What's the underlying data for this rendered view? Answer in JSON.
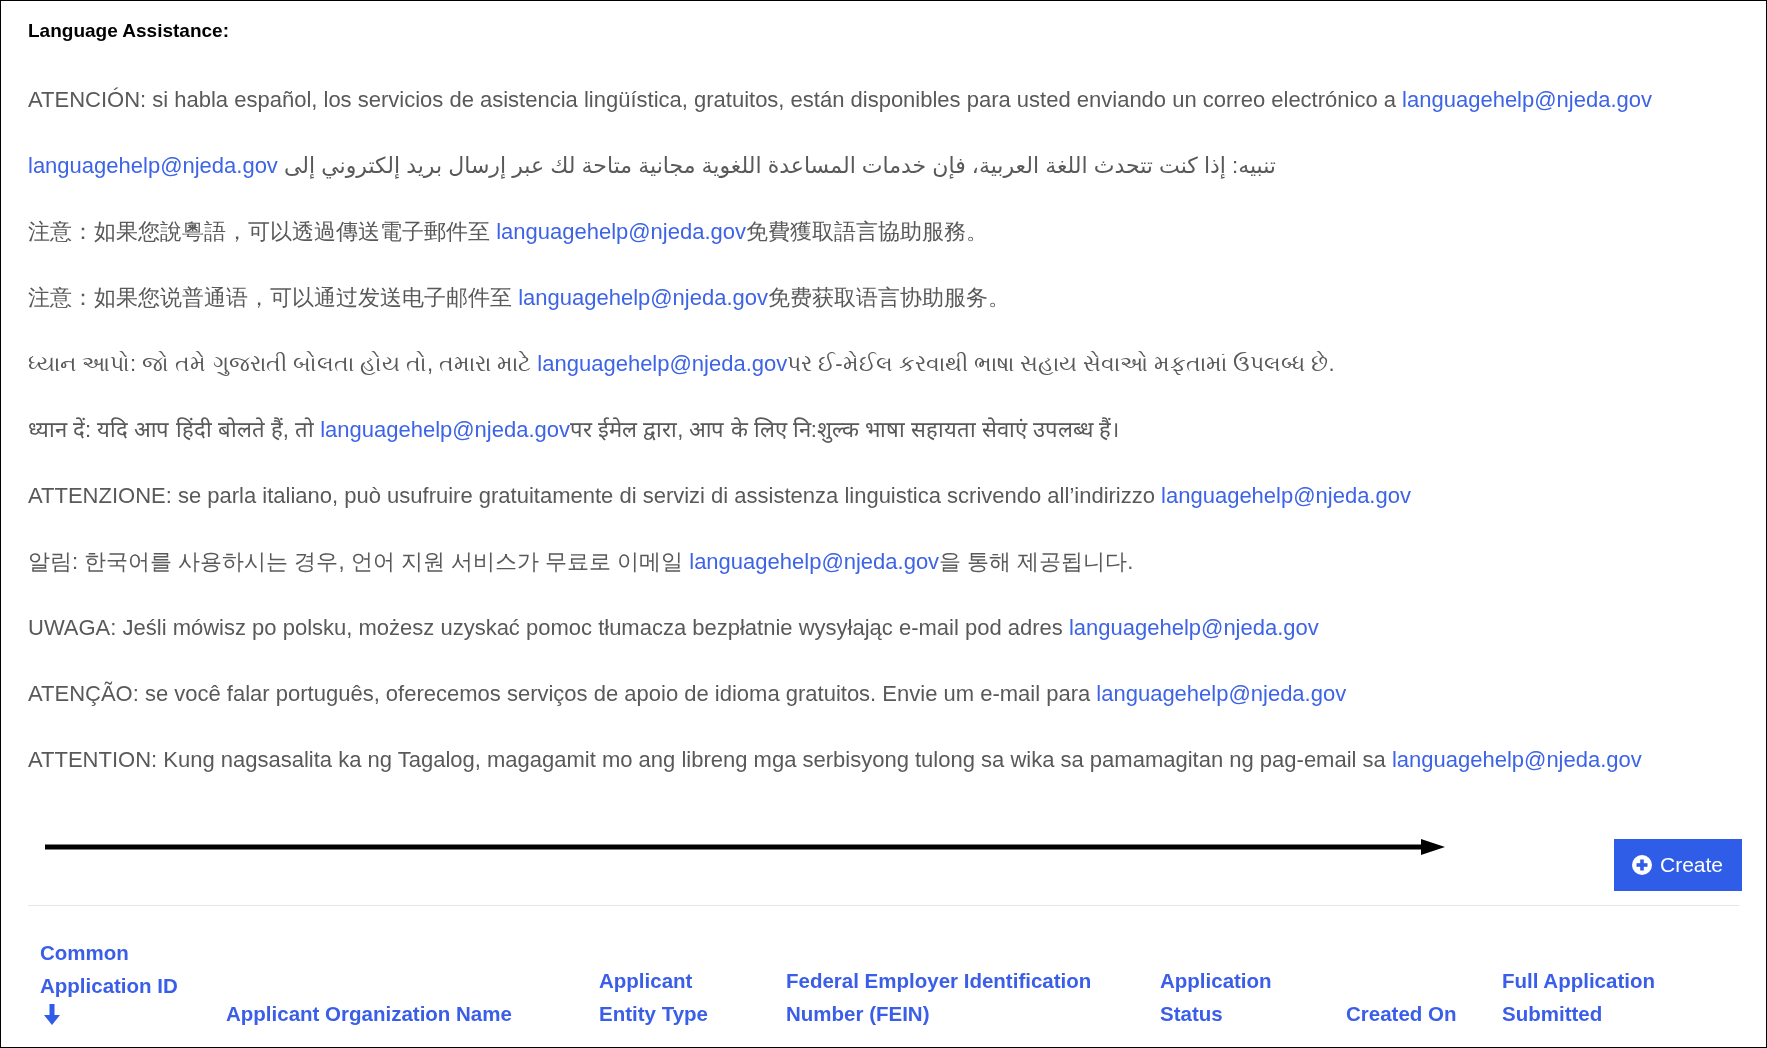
{
  "heading": "Language Assistance:",
  "notices": [
    {
      "before": "ATENCIÓN: si habla español, los servicios de asistencia lingüística, gratuitos, están disponibles para usted enviando un correo electrónico a",
      "email": "languagehelp@njeda.gov"
    },
    {
      "kind": "rtl",
      "before": "تنبيه: إذا كنت تتحدث اللغة العربية، فإن خدمات المساعدة اللغوية مجانية متاحة لك عبر إرسال بريد إلكتروني إلى",
      "email": "languagehelp@njeda.gov"
    },
    {
      "before": "注意：如果您說粵語，可以透過傳送電子郵件至",
      "email": "languagehelp@njeda.gov",
      "after": "免費獲取語言協助服務。"
    },
    {
      "before": "注意：如果您说普通语，可以通过发送电子邮件至",
      "email": "languagehelp@njeda.gov",
      "after": "免费获取语言协助服务。"
    },
    {
      "before": "ધ્યાન આપો: જો તમે ગુજરાતી બોલતા હોય તો, તમારા માટે",
      "email": "languagehelp@njeda.gov",
      "after": "પર ઈ-મેઈલ કરવાથી ભાષા સહાય સેવાઓ મફતામાં ઉપલબ્ધ છે."
    },
    {
      "before": "ध्यान दें: यदि आप हिंदी बोलते हैं, तो",
      "email": "languagehelp@njeda.gov",
      "after": "पर ईमेल द्वारा, आप के लिए नि:शुल्क भाषा सहायता सेवाएं उपलब्ध हैं।"
    },
    {
      "before": "ATTENZIONE: se parla italiano, può usufruire gratuitamente di servizi di assistenza linguistica scrivendo all’indirizzo",
      "email": "languagehelp@njeda.gov"
    },
    {
      "before": "알림: 한국어를 사용하시는 경우, 언어 지원 서비스가 무료로 이메일",
      "email": "languagehelp@njeda.gov",
      "after": "을 통해 제공됩니다."
    },
    {
      "before": "UWAGA: Jeśli mówisz po polsku, możesz uzyskać pomoc tłumacza bezpłatnie wysyłając e-mail pod adres",
      "email": "languagehelp@njeda.gov"
    },
    {
      "before": "ATENÇÃO: se você falar português, oferecemos serviços de apoio de idioma gratuitos. Envie um e-mail para",
      "email": "languagehelp@njeda.gov"
    },
    {
      "before": "ATTENTION: Kung nagsasalita ka ng Tagalog, magagamit mo ang libreng mga serbisyong tulong sa wika sa pamamagitan ng pag-email sa",
      "email": "languagehelp@njeda.gov"
    }
  ],
  "create_button": {
    "label": "Create"
  },
  "table": {
    "columns": [
      {
        "label": "Common Application ID",
        "sorted": true
      },
      {
        "label": "Applicant Organization Name",
        "sorted": false
      },
      {
        "label": "Applicant Entity Type",
        "sorted": false
      },
      {
        "label": "Federal Employer Identification Number (FEIN)",
        "sorted": false
      },
      {
        "label": "Application Status",
        "sorted": false
      },
      {
        "label": "Created On",
        "sorted": false
      },
      {
        "label": "Full Application Submitted",
        "sorted": false
      }
    ]
  }
}
